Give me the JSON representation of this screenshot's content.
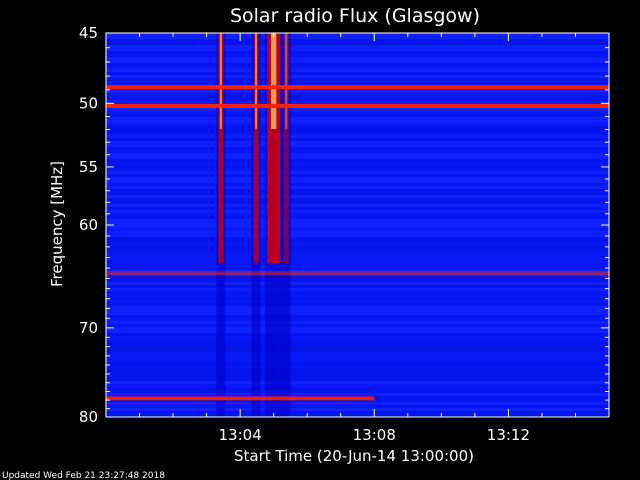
{
  "chart_data": {
    "type": "heatmap",
    "title": "Solar radio Flux (Glasgow)",
    "xlabel": "Start Time (20-Jun-14 13:00:00)",
    "ylabel": "Frequency [MHz]",
    "xlim": [
      0,
      15
    ],
    "ylim": [
      45,
      80
    ],
    "y_inverted": true,
    "y_scale": "log",
    "x_ticks": [
      {
        "value": 4,
        "label": "13:04"
      },
      {
        "value": 8,
        "label": "13:08"
      },
      {
        "value": 12,
        "label": "13:12"
      }
    ],
    "y_ticks": [
      {
        "value": 45,
        "label": "45"
      },
      {
        "value": 50,
        "label": "50"
      },
      {
        "value": 55,
        "label": "55"
      },
      {
        "value": 60,
        "label": "60"
      },
      {
        "value": 70,
        "label": "70"
      },
      {
        "value": 80,
        "label": "80"
      }
    ],
    "colors": {
      "background": "#0a1aff",
      "low": "#0000c8",
      "mid": "#d80000",
      "high": "#ff2000",
      "peak": "#ffe060"
    },
    "bursts": [
      {
        "start_min": 3.35,
        "end_min": 3.5,
        "intensity": 0.9
      },
      {
        "start_min": 4.4,
        "end_min": 4.55,
        "intensity": 0.85
      },
      {
        "start_min": 4.8,
        "end_min": 5.2,
        "intensity": 1.0
      },
      {
        "start_min": 5.3,
        "end_min": 5.45,
        "intensity": 0.6
      }
    ],
    "interference_lines": [
      {
        "freq_mhz": 48.8,
        "start_min": 0,
        "end_min": 15,
        "intensity": 1.0
      },
      {
        "freq_mhz": 50.2,
        "start_min": 0,
        "end_min": 15,
        "intensity": 1.0
      },
      {
        "freq_mhz": 64.5,
        "start_min": 0,
        "end_min": 15,
        "intensity": 0.5
      },
      {
        "freq_mhz": 77.8,
        "start_min": 0,
        "end_min": 8,
        "intensity": 0.9
      }
    ]
  },
  "footer": {
    "updated": "Updated Wed Feb 21 23:27:48 2018"
  }
}
